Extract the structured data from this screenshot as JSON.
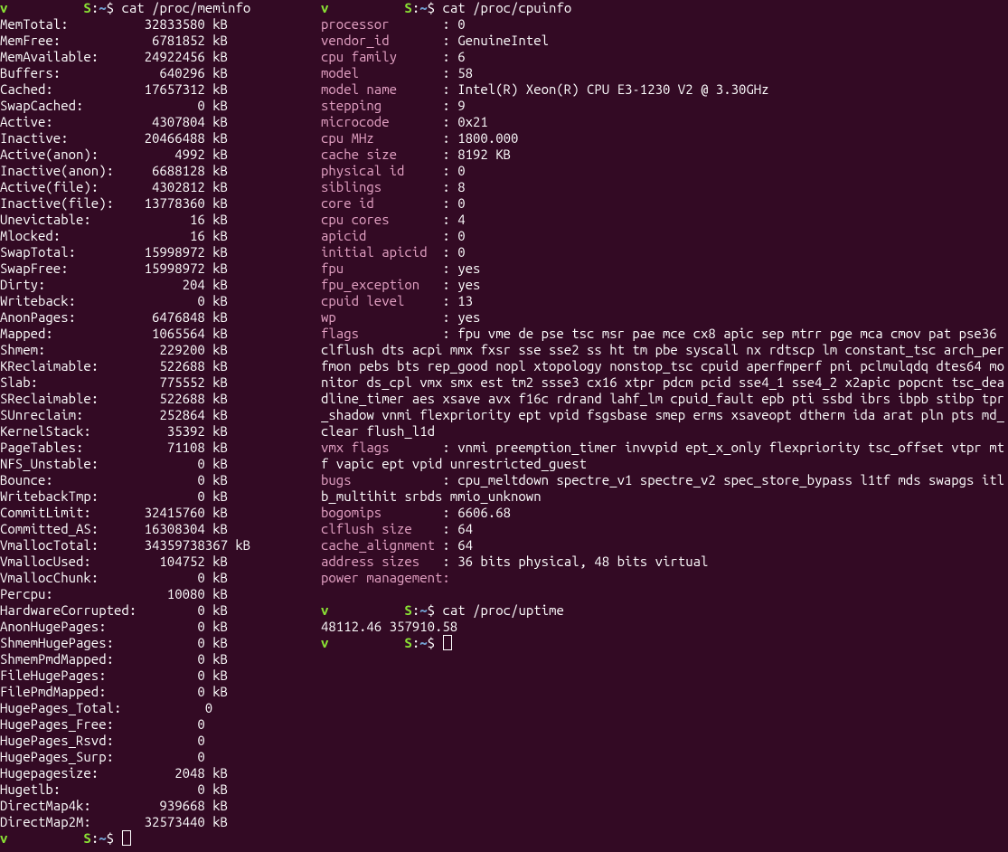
{
  "prompt": {
    "user": "v",
    "host": "S",
    "sep_uh": "          ",
    "dir": "~",
    "symbol": "$"
  },
  "left": {
    "command": "cat /proc/meminfo",
    "kv_col_key_w": 15,
    "kv_col_val_w": 12,
    "rows": [
      {
        "k": "MemTotal:",
        "v": "32833580",
        "u": "kB"
      },
      {
        "k": "MemFree:",
        "v": "6781852",
        "u": "kB"
      },
      {
        "k": "MemAvailable:",
        "v": "24922456",
        "u": "kB"
      },
      {
        "k": "Buffers:",
        "v": "640296",
        "u": "kB"
      },
      {
        "k": "Cached:",
        "v": "17657312",
        "u": "kB"
      },
      {
        "k": "SwapCached:",
        "v": "0",
        "u": "kB"
      },
      {
        "k": "Active:",
        "v": "4307804",
        "u": "kB"
      },
      {
        "k": "Inactive:",
        "v": "20466488",
        "u": "kB"
      },
      {
        "k": "Active(anon):",
        "v": "4992",
        "u": "kB"
      },
      {
        "k": "Inactive(anon):",
        "v": "6688128",
        "u": "kB"
      },
      {
        "k": "Active(file):",
        "v": "4302812",
        "u": "kB"
      },
      {
        "k": "Inactive(file):",
        "v": "13778360",
        "u": "kB"
      },
      {
        "k": "Unevictable:",
        "v": "16",
        "u": "kB"
      },
      {
        "k": "Mlocked:",
        "v": "16",
        "u": "kB"
      },
      {
        "k": "SwapTotal:",
        "v": "15998972",
        "u": "kB"
      },
      {
        "k": "SwapFree:",
        "v": "15998972",
        "u": "kB"
      },
      {
        "k": "Dirty:",
        "v": "204",
        "u": "kB"
      },
      {
        "k": "Writeback:",
        "v": "0",
        "u": "kB"
      },
      {
        "k": "AnonPages:",
        "v": "6476848",
        "u": "kB"
      },
      {
        "k": "Mapped:",
        "v": "1065564",
        "u": "kB"
      },
      {
        "k": "Shmem:",
        "v": "229200",
        "u": "kB"
      },
      {
        "k": "KReclaimable:",
        "v": "522688",
        "u": "kB"
      },
      {
        "k": "Slab:",
        "v": "775552",
        "u": "kB"
      },
      {
        "k": "SReclaimable:",
        "v": "522688",
        "u": "kB"
      },
      {
        "k": "SUnreclaim:",
        "v": "252864",
        "u": "kB"
      },
      {
        "k": "KernelStack:",
        "v": "35392",
        "u": "kB"
      },
      {
        "k": "PageTables:",
        "v": "71108",
        "u": "kB"
      },
      {
        "k": "NFS_Unstable:",
        "v": "0",
        "u": "kB"
      },
      {
        "k": "Bounce:",
        "v": "0",
        "u": "kB"
      },
      {
        "k": "WritebackTmp:",
        "v": "0",
        "u": "kB"
      },
      {
        "k": "CommitLimit:",
        "v": "32415760",
        "u": "kB"
      },
      {
        "k": "Committed_AS:",
        "v": "16308304",
        "u": "kB"
      },
      {
        "k": "VmallocTotal:",
        "v": "34359738367",
        "u": "kB",
        "wide": true
      },
      {
        "k": "VmallocUsed:",
        "v": "104752",
        "u": "kB"
      },
      {
        "k": "VmallocChunk:",
        "v": "0",
        "u": "kB"
      },
      {
        "k": "Percpu:",
        "v": "10080",
        "u": "kB"
      },
      {
        "k": "HardwareCorrupted:",
        "v": "0",
        "u": "kB",
        "nospace_key": true
      },
      {
        "k": "AnonHugePages:",
        "v": "0",
        "u": "kB"
      },
      {
        "k": "ShmemHugePages:",
        "v": "0",
        "u": "kB"
      },
      {
        "k": "ShmemPmdMapped:",
        "v": "0",
        "u": "kB"
      },
      {
        "k": "FileHugePages:",
        "v": "0",
        "u": "kB"
      },
      {
        "k": "FilePmdMapped:",
        "v": "0",
        "u": "kB"
      },
      {
        "k": "HugePages_Total:",
        "v": "0",
        "u": ""
      },
      {
        "k": "HugePages_Free:",
        "v": "0",
        "u": ""
      },
      {
        "k": "HugePages_Rsvd:",
        "v": "0",
        "u": ""
      },
      {
        "k": "HugePages_Surp:",
        "v": "0",
        "u": ""
      },
      {
        "k": "Hugepagesize:",
        "v": "2048",
        "u": "kB"
      },
      {
        "k": "Hugetlb:",
        "v": "0",
        "u": "kB"
      },
      {
        "k": "DirectMap4k:",
        "v": "939668",
        "u": "kB"
      },
      {
        "k": "DirectMap2M:",
        "v": "32573440",
        "u": "kB"
      }
    ]
  },
  "right": {
    "command1": "cat /proc/cpuinfo",
    "cpu": [
      {
        "k": "processor",
        "v": "0"
      },
      {
        "k": "vendor_id",
        "v": "GenuineIntel"
      },
      {
        "k": "cpu family",
        "v": "6"
      },
      {
        "k": "model",
        "v": "58"
      },
      {
        "k": "model name",
        "v": "Intel(R) Xeon(R) CPU E3-1230 V2 @ 3.30GHz"
      },
      {
        "k": "stepping",
        "v": "9"
      },
      {
        "k": "microcode",
        "v": "0x21"
      },
      {
        "k": "cpu MHz",
        "v": "1800.000"
      },
      {
        "k": "cache size",
        "v": "8192 KB"
      },
      {
        "k": "physical id",
        "v": "0"
      },
      {
        "k": "siblings",
        "v": "8"
      },
      {
        "k": "core id",
        "v": "0"
      },
      {
        "k": "cpu cores",
        "v": "4"
      },
      {
        "k": "apicid",
        "v": "0"
      },
      {
        "k": "initial apicid",
        "v": "0"
      },
      {
        "k": "fpu",
        "v": "yes"
      },
      {
        "k": "fpu_exception",
        "v": "yes"
      },
      {
        "k": "cpuid level",
        "v": "13"
      },
      {
        "k": "wp",
        "v": "yes"
      }
    ],
    "flags_key": "flags",
    "flags_val": "fpu vme de pse tsc msr pae mce cx8 apic sep mtrr pge mca cmov pat pse36 clflush dts acpi mmx fxsr sse sse2 ss ht tm pbe syscall nx rdtscp lm constant_tsc arch_perfmon pebs bts rep_good nopl xtopology nonstop_tsc cpuid aperfmperf pni pclmulqdq dtes64 monitor ds_cpl vmx smx est tm2 ssse3 cx16 xtpr pdcm pcid sse4_1 sse4_2 x2apic popcnt tsc_deadline_timer aes xsave avx f16c rdrand lahf_lm cpuid_fault epb pti ssbd ibrs ibpb stibp tpr_shadow vnmi flexpriority ept vpid fsgsbase smep erms xsaveopt dtherm ida arat pln pts md_clear flush_l1d",
    "vmx_key": "vmx flags",
    "vmx_val": "vnmi preemption_timer invvpid ept_x_only flexpriority tsc_offset vtpr mtf vapic ept vpid unrestricted_guest",
    "bugs_key": "bugs",
    "bugs_val": "cpu_meltdown spectre_v1 spectre_v2 spec_store_bypass l1tf mds swapgs itlb_multihit srbds mmio_unknown",
    "tail": [
      {
        "k": "bogomips",
        "v": "6606.68"
      },
      {
        "k": "clflush size",
        "v": "64"
      },
      {
        "k": "cache_alignment",
        "v": "64"
      },
      {
        "k": "address sizes",
        "v": "36 bits physical, 48 bits virtual"
      },
      {
        "k": "power management:",
        "v": "",
        "nocolon": true
      }
    ],
    "command2": "cat /proc/uptime",
    "uptime": "48112.46 357910.58"
  }
}
